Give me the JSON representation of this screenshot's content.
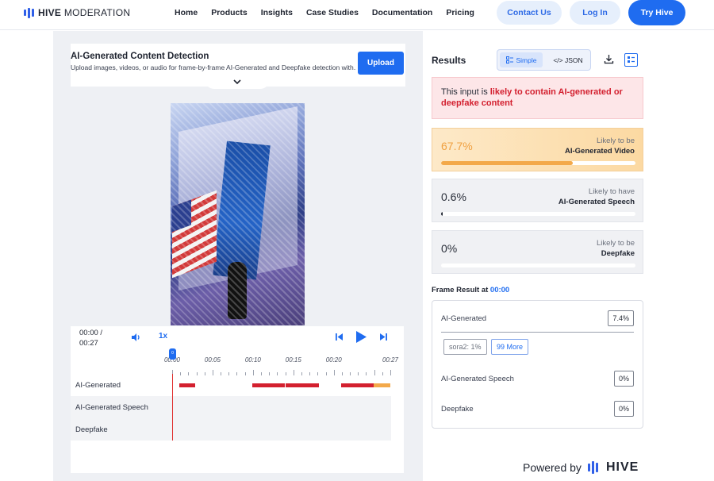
{
  "header": {
    "logo_bold": "HIVE",
    "logo_light": " MODERATION",
    "nav": [
      "Home",
      "Products",
      "Insights",
      "Case Studies",
      "Documentation",
      "Pricing"
    ],
    "contact_label": "Contact Us",
    "login_label": "Log In",
    "try_label": "Try Hive"
  },
  "tool": {
    "title": "AI-Generated Content Detection",
    "description": "Upload images, videos, or audio for frame-by-frame AI-Generated and Deepfake detection with...",
    "upload_label": "Upload"
  },
  "player": {
    "current_time": "00:00 /",
    "duration": "00:27",
    "speed": "1x",
    "playhead_label": "0",
    "tick_labels": [
      "00:00",
      "00:05",
      "00:10",
      "00:15",
      "00:20",
      "00:27"
    ],
    "tracks": [
      {
        "label": "AI-Generated"
      },
      {
        "label": "AI-Generated Speech"
      },
      {
        "label": "Deepfake"
      }
    ],
    "segments": [
      {
        "track": 0,
        "start": 0.9,
        "end": 2.8,
        "color": "#d3202f"
      },
      {
        "track": 0,
        "start": 9.9,
        "end": 11.9,
        "color": "#d3202f"
      },
      {
        "track": 0,
        "start": 11.9,
        "end": 13.9,
        "color": "#d3202f"
      },
      {
        "track": 0,
        "start": 14.0,
        "end": 18.2,
        "color": "#d3202f"
      },
      {
        "track": 0,
        "start": 20.9,
        "end": 25.0,
        "color": "#d3202f"
      },
      {
        "track": 0,
        "start": 24.9,
        "end": 27.0,
        "color": "#f3a94a"
      }
    ]
  },
  "results": {
    "title": "Results",
    "simple_label": "Simple",
    "json_label": "</> JSON",
    "verdict_prefix": "This input is ",
    "verdict_highlight": "likely to contain AI-generated or deepfake content",
    "scores": [
      {
        "value": "67.7%",
        "fraction": 0.677,
        "label1": "Likely to be",
        "label2": "AI-Generated Video",
        "color": "#f3a94a"
      },
      {
        "value": "0.6%",
        "fraction": 0.006,
        "label1": "Likely to have",
        "label2": "AI-Generated Speech",
        "color": "#1f2430"
      },
      {
        "value": "0%",
        "fraction": 0.0,
        "label1": "Likely to be",
        "label2": "Deepfake",
        "color": "#1f2430"
      }
    ]
  },
  "frame_result": {
    "title_prefix": "Frame Result at ",
    "time": "00:00",
    "ai_label": "AI-Generated",
    "ai_value": "7.4%",
    "chip_sora": "sora2: 1%",
    "chip_more": "99 More",
    "speech_label": "AI-Generated Speech",
    "speech_value": "0%",
    "deepfake_label": "Deepfake",
    "deepfake_value": "0%"
  },
  "footer": {
    "powered_by": "Powered by",
    "brand": "HIVE"
  },
  "colors": {
    "accent": "#1f6cf0",
    "danger": "#d3202f",
    "warning": "#f3a94a"
  }
}
